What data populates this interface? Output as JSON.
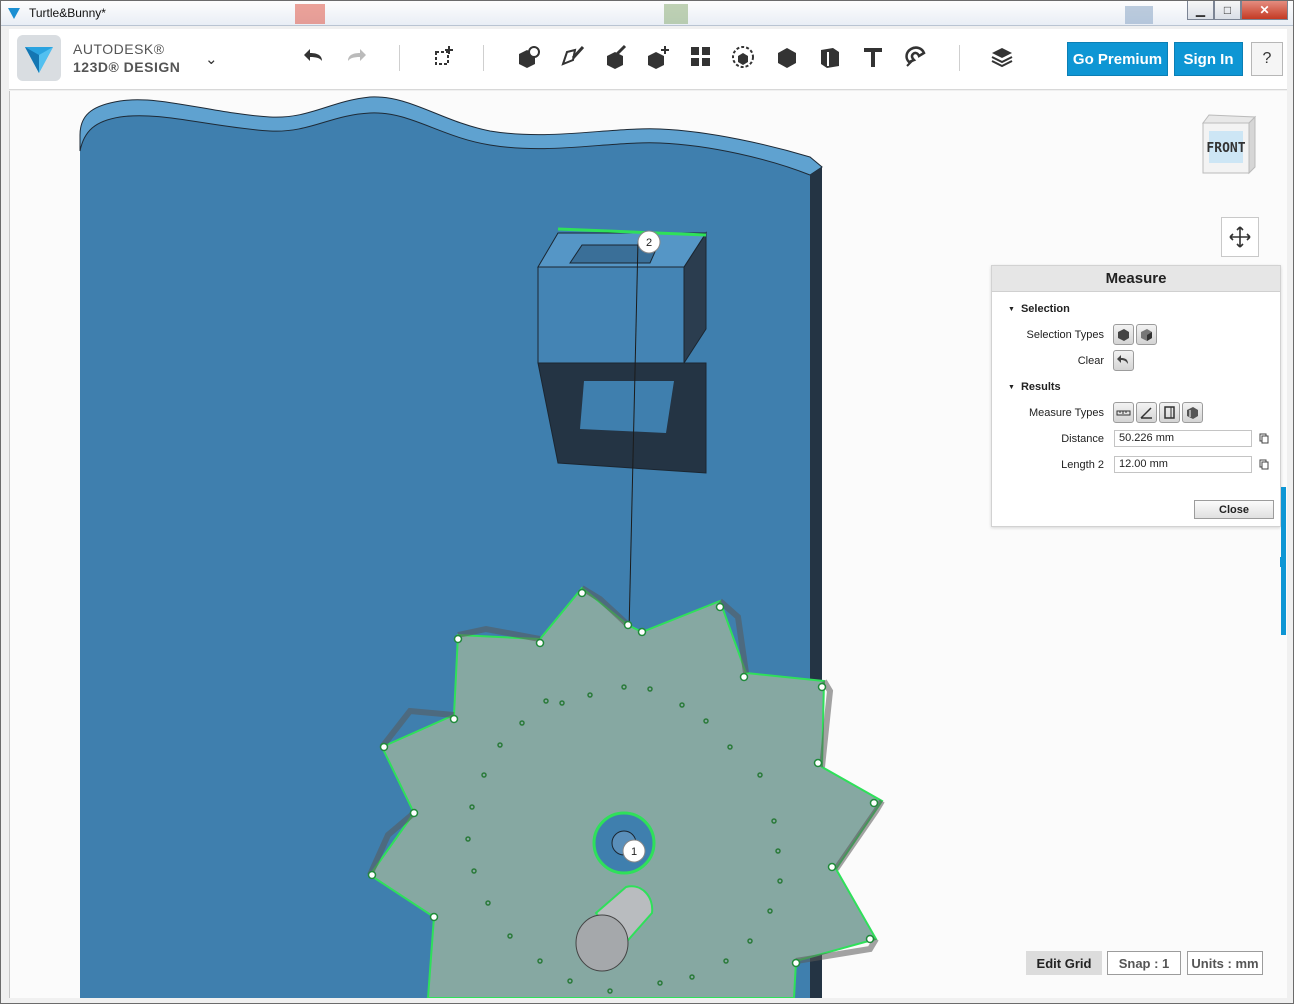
{
  "window": {
    "title": "Turtle&Bunny*"
  },
  "window_controls": {
    "minimize": "▁",
    "maximize": "□",
    "close": "✕"
  },
  "brand": {
    "line1": "AUTODESK®",
    "line2": "123D® DESIGN"
  },
  "toolbar": {
    "premium_label": "Go Premium",
    "signin_label": "Sign In",
    "help_label": "?"
  },
  "viewcube": {
    "label": "FRONT"
  },
  "measure_panel": {
    "title": "Measure",
    "selection_section": "Selection",
    "selection_types_label": "Selection Types",
    "clear_label": "Clear",
    "results_section": "Results",
    "measure_types_label": "Measure Types",
    "distance_label": "Distance",
    "distance_value": "50.226 mm",
    "length2_label": "Length 2",
    "length2_value": "12.00 mm",
    "close_label": "Close"
  },
  "markers": {
    "m1": "1",
    "m2": "2"
  },
  "status": {
    "edit_grid": "Edit Grid",
    "snap": "Snap : 1",
    "units": "Units : mm"
  },
  "colors": {
    "accent": "#0e96d4",
    "plate": "#3f7fae",
    "plate_dark": "#253646",
    "gear": "#86a8a2",
    "selection": "#2fe05a"
  }
}
